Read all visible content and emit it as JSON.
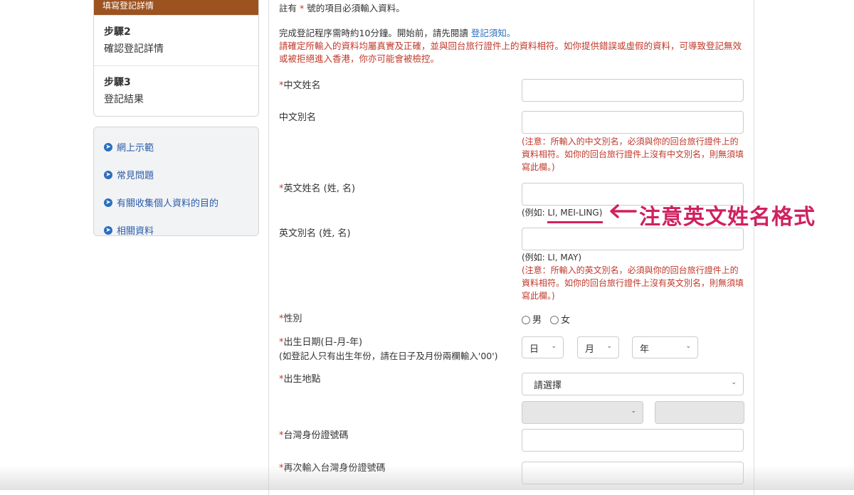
{
  "sidebar": {
    "active_step_label": "填寫登記詳情",
    "steps": [
      {
        "num": "步驟2",
        "name": "確認登記詳情"
      },
      {
        "num": "步驟3",
        "name": "登記結果"
      }
    ],
    "links": [
      "網上示範",
      "常見問題",
      "有關收集個人資料的目的",
      "相關資料"
    ]
  },
  "form": {
    "required_note_prefix": "註有",
    "required_star": "*",
    "required_note_suffix": "號的項目必須輸入資料。",
    "intro_text": "完成登記程序需時約10分鐘。開始前，請先閱讀",
    "intro_link": "登記須知",
    "intro_period": "。",
    "warning_text": "請確定所輸入的資料均屬真實及正確，並與回台旅行證件上的資料相符。如你提供錯誤或虛假的資料，可導致登記無效或被拒絕進入香港，你亦可能會被檢控。",
    "star": "*",
    "chinese_name_label": "中文姓名",
    "chinese_alias_label": "中文別名",
    "chinese_alias_note": "(注意：所輸入的中文別名，必須與你的回台旅行證件上的資料相符。如你的回台旅行證件上沒有中文別名，則無須填寫此欄。)",
    "english_name_label": "英文姓名 (姓, 名)",
    "english_name_hint": "(例如: LI, MEI-LING)",
    "english_alias_label": "英文別名 (姓, 名)",
    "english_alias_hint": "(例如: LI, MAY)",
    "english_alias_note": "(注意：所輸入的英文別名，必須與你的回台旅行證件上的資料相符。如你的回台旅行證件上沒有英文別名，則無須填寫此欄。)",
    "gender_label": "性別",
    "gender_male": "男",
    "gender_female": "女",
    "dob_label": "出生日期(日-月-年)",
    "dob_note": "(如登記人只有出生年份，請在日子及月份兩欄輸入'00')",
    "dob_day": "日",
    "dob_month": "月",
    "dob_year": "年",
    "birthplace_label": "出生地點",
    "birthplace_select": "請選擇",
    "tw_id_label": "台灣身份證號碼",
    "tw_id_confirm_label": "再次輸入台灣身份證號碼"
  },
  "annotation": {
    "text": "注意英文姓名格式",
    "color": "#d0215f"
  },
  "colors": {
    "accent_brown": "#9c5320",
    "link_blue": "#2b6fbe",
    "warning_red": "#c0392b"
  }
}
